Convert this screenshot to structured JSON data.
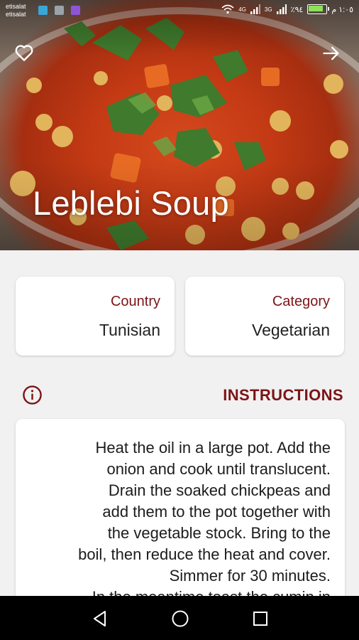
{
  "status_bar": {
    "carrier_line1": "etisalat",
    "carrier_line2": "etisalat",
    "network1": "4G",
    "network2": "3G",
    "battery_pct_text": "٪٩٤",
    "time": "١:٠٥ م",
    "battery_level": 0.9
  },
  "recipe": {
    "title": "Leblebi Soup"
  },
  "header": {
    "favorite_icon": "heart-outline-icon",
    "share_icon": "arrow-right-icon"
  },
  "country_card": {
    "label": "Country",
    "value": "Tunisian"
  },
  "category_card": {
    "label": "Category",
    "value": "Vegetarian"
  },
  "instructions": {
    "heading": "INSTRUCTIONS",
    "icon": "info-circle-icon",
    "lines": [
      "Heat the oil in a large pot. Add the",
      "onion and cook until translucent.",
      "Drain the soaked chickpeas and",
      "add them to the pot together with",
      "the vegetable stock. Bring to the",
      "boil, then reduce the heat and cover.",
      "Simmer for 30 minutes.",
      "In the meantime toast the cumin in"
    ]
  },
  "colors": {
    "accent": "#7c1416",
    "background": "#f1f1f1",
    "card": "#ffffff"
  },
  "navigation": {
    "back_icon": "triangle-back-icon",
    "home_icon": "circle-home-icon",
    "recents_icon": "square-recents-icon"
  }
}
